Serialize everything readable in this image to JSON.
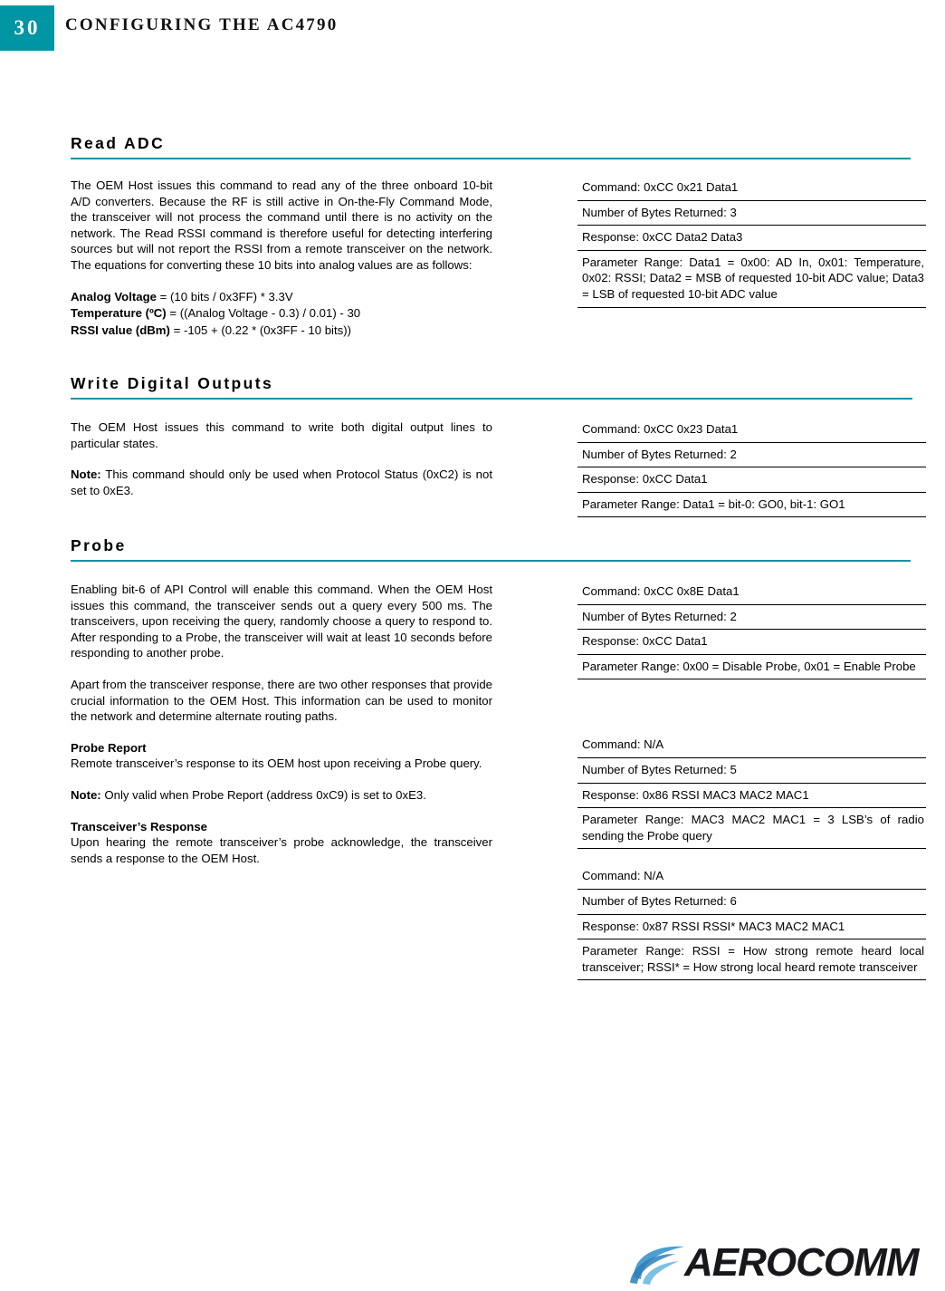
{
  "header": {
    "page_number": "30",
    "title": "CONFIGURING THE AC4790",
    "accent_color": "#0095a3"
  },
  "sections": [
    {
      "id": "read-adc",
      "heading": "Read ADC",
      "body": {
        "paragraph": "The OEM Host issues this command to read any of the three onboard 10-bit A/D converters.  Because the RF is still active in On-the-Fly Command Mode, the transceiver will not process the command until there is no activity on the network.  The Read RSSI command is therefore useful for detecting interfering sources but will not report the RSSI from a remote transceiver on the network.  The equations for converting these 10 bits into analog values are as follows:",
        "formulas": [
          {
            "label": "Analog Voltage",
            "equation": " = (10 bits / 0x3FF) * 3.3V"
          },
          {
            "label": "Temperature (ºC)",
            "equation": " = ((Analog Voltage - 0.3) / 0.01) - 30"
          },
          {
            "label": "RSSI value (dBm)",
            "equation": " = -105 + (0.22 * (0x3FF - 10 bits))"
          }
        ]
      },
      "spec": {
        "command": "Command: 0xCC 0x21 Data1",
        "bytes_returned": "Number of Bytes Returned: 3",
        "response": "Response: 0xCC Data2 Data3",
        "parameter_range": "Parameter Range: Data1 = 0x00: AD In, 0x01: Temperature, 0x02: RSSI; Data2 = MSB of requested 10-bit ADC value; Data3 = LSB of requested 10-bit ADC value"
      }
    },
    {
      "id": "write-digital-outputs",
      "heading": "Write Digital Outputs",
      "body": {
        "paragraph": "The OEM Host issues this command to write both digital output lines to particular states.",
        "note_label": "Note:",
        "note_text": " This command should only be used when Protocol Status (0xC2) is not set to 0xE3."
      },
      "spec": {
        "command": "Command: 0xCC 0x23 Data1",
        "bytes_returned": "Number of Bytes Returned: 2",
        "response": "Response: 0xCC Data1",
        "parameter_range": "Parameter Range: Data1 = bit-0: GO0, bit-1: GO1"
      }
    },
    {
      "id": "probe",
      "heading": "Probe",
      "body": {
        "paragraph1": "Enabling bit-6 of API Control will enable this command.  When the OEM Host issues this command, the transceiver sends out a query every 500 ms.  The transceivers, upon receiving the query, randomly choose a query to respond to.  After responding to a Probe, the transceiver will wait at least 10 seconds before responding to another probe.",
        "paragraph2": "Apart from the transceiver response, there are two other responses that provide crucial information to the OEM Host.  This information can be used to monitor the network and determine alternate routing paths.",
        "probe_report_heading": "Probe Report",
        "probe_report_text": "Remote transceiver’s response to its OEM host upon receiving a Probe query.",
        "note_label": "Note:",
        "note_text": " Only valid when Probe Report (address 0xC9) is set to 0xE3.",
        "transceiver_response_heading": "Transceiver’s Response",
        "transceiver_response_text": "Upon hearing the remote transceiver’s probe acknowledge, the transceiver sends a response to the OEM Host."
      },
      "specs": [
        {
          "command": "Command: 0xCC 0x8E Data1",
          "bytes_returned": "Number of Bytes Returned: 2",
          "response": "Response: 0xCC Data1",
          "parameter_range": "Parameter Range: 0x00 = Disable Probe, 0x01 = Enable Probe"
        },
        {
          "command": "Command: N/A",
          "bytes_returned": "Number of Bytes Returned: 5",
          "response": "Response: 0x86 RSSI MAC3 MAC2 MAC1",
          "parameter_range": "Parameter Range: MAC3 MAC2 MAC1 = 3 LSB’s of radio sending the Probe query"
        },
        {
          "command": "Command: N/A",
          "bytes_returned": "Number of Bytes Returned: 6",
          "response": "Response: 0x87 RSSI RSSI* MAC3 MAC2 MAC1",
          "parameter_range": "Parameter Range: RSSI = How strong remote heard local transceiver; RSSI* = How strong local heard remote transceiver"
        }
      ]
    }
  ],
  "footer": {
    "logo_text": "AEROCOMM",
    "logo_swoosh_color": "#4a9fd4"
  }
}
